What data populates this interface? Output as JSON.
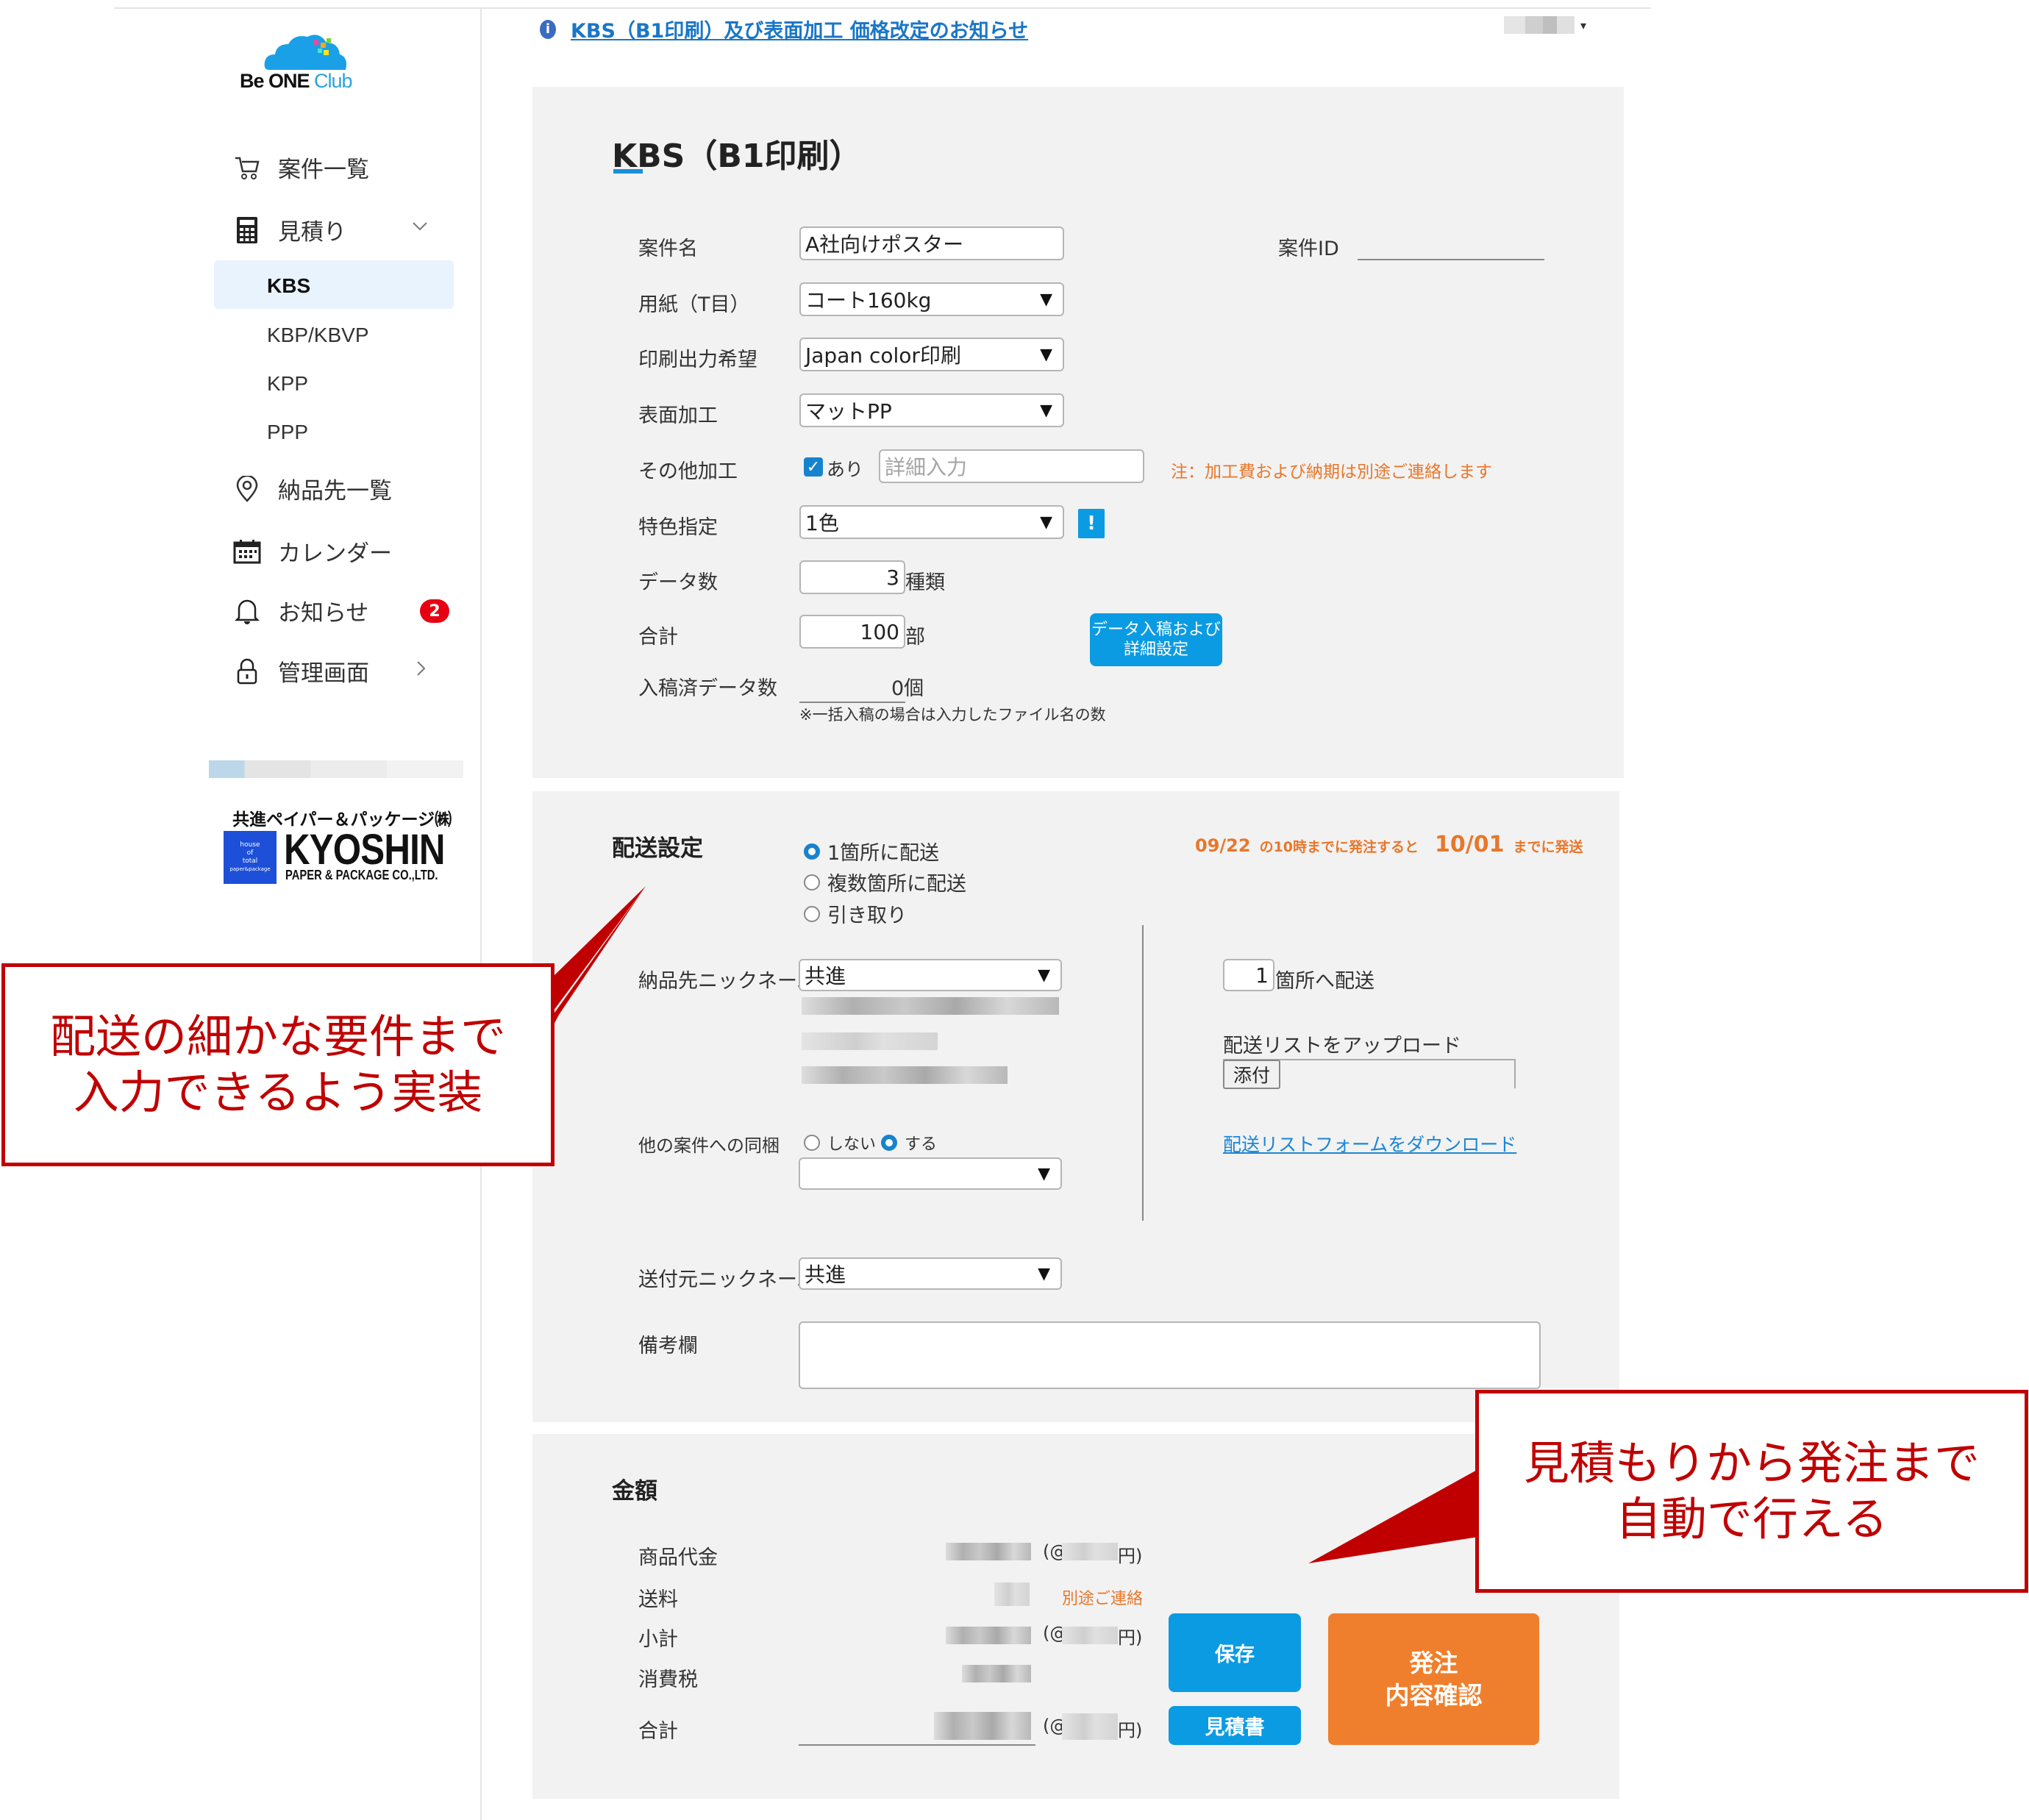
{
  "brand": {
    "logo_text_main": "Be ONE",
    "logo_text_accent": "Club"
  },
  "notice": {
    "icon": "info-icon",
    "text": "KBS（B1印刷）及び表面加工  価格改定のお知らせ"
  },
  "user_menu": {
    "caret": "▾"
  },
  "sidebar": {
    "items": [
      {
        "label": "案件一覧",
        "icon": "cart-icon"
      },
      {
        "label": "見積り",
        "icon": "calculator-icon",
        "expanded": true
      },
      {
        "label": "納品先一覧",
        "icon": "location-pin-icon"
      },
      {
        "label": "カレンダー",
        "icon": "calendar-icon"
      },
      {
        "label": "お知らせ",
        "icon": "bell-icon",
        "badge": "2"
      },
      {
        "label": "管理画面",
        "icon": "lock-icon"
      }
    ],
    "sub_items": [
      {
        "label": "KBS",
        "active": true
      },
      {
        "label": "KBP/KBVP"
      },
      {
        "label": "KPP"
      },
      {
        "label": "PPP"
      }
    ],
    "company": {
      "name_jp": "共進ペイパー＆パッケージ㈱",
      "name_en": "KYOSHIN",
      "sub": "PAPER & PACKAGE CO.,LTD.",
      "box_lines": [
        "house",
        "of",
        "total",
        "paper&package"
      ]
    }
  },
  "product": {
    "title": "KBS（B1印刷）",
    "fields": {
      "project_name_label": "案件名",
      "project_name_value": "A社向けポスター",
      "project_id_label": "案件ID",
      "project_id_value": "",
      "paper_label": "用紙（T目）",
      "paper_value": "コート160kg",
      "print_label": "印刷出力希望",
      "print_value": "Japan color印刷",
      "surface_label": "表面加工",
      "surface_value": "マットPP",
      "other_label": "その他加工",
      "other_checked_label": "あり",
      "other_checked": true,
      "other_placeholder": "詳細入力",
      "other_note": "注：加工費および納期は別途ご連絡します",
      "spot_label": "特色指定",
      "spot_value": "1色",
      "spot_info": "!",
      "data_count_label": "データ数",
      "data_count_value": "3",
      "data_count_unit": "種類",
      "total_label": "合計",
      "total_value": "100",
      "total_unit": "部",
      "data_button": [
        "データ入稿および",
        "詳細設定"
      ],
      "submitted_label": "入稿済データ数",
      "submitted_value": "0個",
      "submitted_note": "※一括入稿の場合は入力したファイル名の数"
    }
  },
  "shipping": {
    "title": "配送設定",
    "options": [
      {
        "label": "1箇所に配送",
        "selected": true
      },
      {
        "label": "複数箇所に配送",
        "selected": false
      },
      {
        "label": "引き取り",
        "selected": false
      }
    ],
    "deadline": {
      "order_date": "09/22",
      "order_text": "の10時までに発注すると",
      "ship_date": "10/01",
      "ship_text": "までに発送"
    },
    "dest_label": "納品先ニックネーム",
    "dest_value": "共進",
    "bundle_label": "他の案件への同梱",
    "bundle_options": [
      {
        "label": "しない",
        "selected": false
      },
      {
        "label": "する",
        "selected": true
      }
    ],
    "bundle_select_value": "",
    "sender_label": "送付元ニックネーム",
    "sender_value": "共進",
    "remarks_label": "備考欄",
    "remarks_value": "",
    "locations_value": "1",
    "locations_unit": "箇所へ配送",
    "upload_label": "配送リストをアップロード",
    "attach_label": "添付",
    "download_link": "配送リストフォームをダウンロード"
  },
  "amount": {
    "title": "金額",
    "rows": [
      {
        "label": "商品代金",
        "unit_prefix": "(@",
        "unit_suffix": "円)"
      },
      {
        "label": "送料",
        "note": "別途ご連絡"
      },
      {
        "label": "小計",
        "unit_prefix": "(@",
        "unit_suffix": "円)"
      },
      {
        "label": "消費税"
      },
      {
        "label": "合計",
        "unit_prefix": "(@",
        "unit_suffix": "円)"
      }
    ],
    "save_label": "保存",
    "quote_label": "見積書",
    "order_label": [
      "発注",
      "内容確認"
    ]
  },
  "callouts": {
    "left": [
      "配送の細かな要件まで",
      "入力できるよう実装"
    ],
    "right": [
      "見積もりから発注まで",
      "自動で行える"
    ]
  },
  "colors": {
    "accent_blue": "#0b9be3",
    "order_orange": "#ef7f2c",
    "note_orange": "#e8772a",
    "callout_red": "#c00000",
    "badge_red": "#e60012"
  }
}
